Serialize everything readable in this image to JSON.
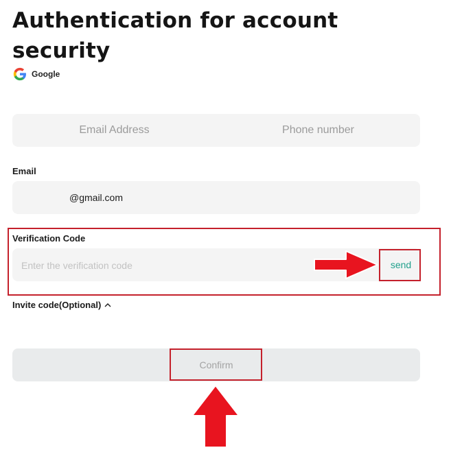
{
  "header": {
    "title": "Authentication for account security",
    "provider": {
      "label": "Google",
      "icon": "google-g-icon"
    }
  },
  "tabs": [
    {
      "label": "Email Address"
    },
    {
      "label": "Phone number"
    }
  ],
  "email": {
    "label": "Email",
    "value": "@gmail.com"
  },
  "verification": {
    "label": "Verification Code",
    "placeholder": "Enter the verification code",
    "send_label": "send"
  },
  "invite": {
    "label": "Invite code(Optional)",
    "icon": "chevron-up-icon"
  },
  "confirm": {
    "label": "Confirm"
  },
  "annotations": {
    "highlight_color": "#c4202b",
    "arrow_color": "#e8141f"
  },
  "colors": {
    "accent": "#21a08c",
    "field_bg": "#f4f4f4",
    "button_disabled_bg": "#e9ebec"
  }
}
